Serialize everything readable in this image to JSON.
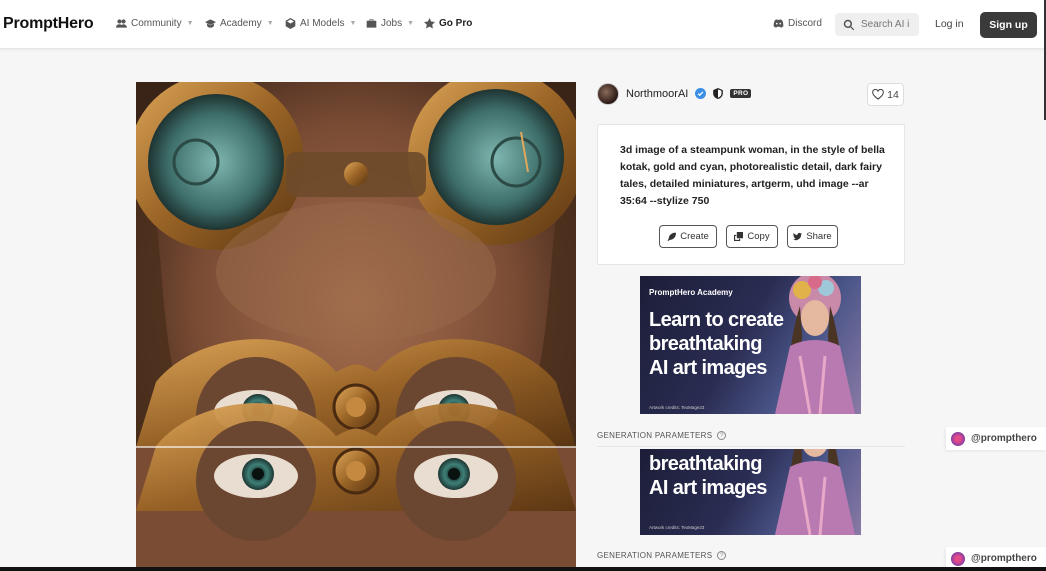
{
  "nav": {
    "logo": "PromptHero",
    "items": [
      {
        "label": "Community"
      },
      {
        "label": "Academy"
      },
      {
        "label": "AI Models"
      },
      {
        "label": "Jobs"
      }
    ],
    "gopro_label": "Go Pro",
    "discord_label": "Discord",
    "search_placeholder": "Search AI i",
    "login_label": "Log in",
    "signup_label": "Sign up"
  },
  "author": {
    "name": "NorthmoorAI",
    "badge": "PRO",
    "likes": "14"
  },
  "prompt": {
    "text": "3d image of a steampunk woman, in the style of bella kotak, gold and cyan, photorealistic detail, dark fairy tales, detailed miniatures, artgerm, uhd image --ar 35:64 --stylize 750",
    "create_label": "Create",
    "copy_label": "Copy",
    "share_label": "Share"
  },
  "ad": {
    "brand": "PromptHero Academy",
    "line1": "Learn to create",
    "line2": "breathtaking",
    "line3": "AI art images",
    "credit": "Artwork credits: TexMage23"
  },
  "generation_params_label": "GENERATION PARAMETERS",
  "side_tag": "@prompthero",
  "colors": {
    "signup_bg": "#3a3a3a",
    "verified": "#3a8ee6",
    "ad_bg": "#1c1e38"
  }
}
